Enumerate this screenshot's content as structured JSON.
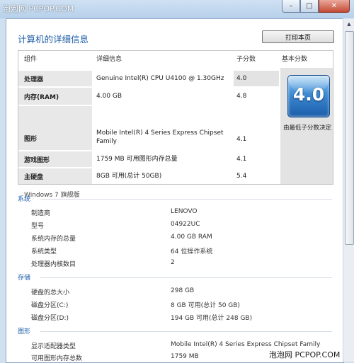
{
  "watermark": "泡泡网 PCPOP.COM",
  "footer_watermark": "泡泡网  PCPOP.COM",
  "window_buttons": {
    "minimize": "–",
    "maximize": "□",
    "close": "✕"
  },
  "page_title": "计算机的详细信息",
  "print_button": "打印本页",
  "table": {
    "headers": {
      "component": "组件",
      "detail": "详细信息",
      "subscore": "子分数",
      "basescore": "基本分数"
    },
    "rows": [
      {
        "name": "处理器",
        "detail": "Genuine Intel(R) CPU U4100 @ 1.30GHz",
        "score": "4.0"
      },
      {
        "name": "内存(RAM)",
        "detail": "4.00 GB",
        "score": "4.8"
      },
      {
        "name": "图形",
        "detail": "Mobile Intel(R) 4 Series Express Chipset Family",
        "score": "4.1"
      },
      {
        "name": "游戏图形",
        "detail": "1759 MB 可用图形内存总量",
        "score": "4.1"
      },
      {
        "name": "主硬盘",
        "detail": "8GB 可用(总计 50GB)",
        "score": "5.4"
      }
    ],
    "base_score": "4.0",
    "base_note": "由最低子分数决定",
    "edition": "Windows 7 旗舰版"
  },
  "sections": {
    "system": {
      "title": "系统",
      "items": [
        {
          "label": "制造商",
          "value": "LENOVO"
        },
        {
          "label": "型号",
          "value": "04922UC"
        },
        {
          "label": "系统内存的总量",
          "value": "4.00 GB RAM"
        },
        {
          "label": "系统类型",
          "value": "64 位操作系统"
        },
        {
          "label": "处理器内核数目",
          "value": "2"
        }
      ]
    },
    "storage": {
      "title": "存储",
      "items": [
        {
          "label": "硬盘的总大小",
          "value": "298 GB"
        },
        {
          "label": "磁盘分区(C:)",
          "value": "8 GB 可用(总计 50 GB)"
        },
        {
          "label": "磁盘分区(D:)",
          "value": "194 GB 可用(总计 248 GB)"
        }
      ]
    },
    "graphics": {
      "title": "图形",
      "items": [
        {
          "label": "显示适配器类型",
          "value": "Mobile Intel(R) 4 Series Express Chipset Family"
        },
        {
          "label": "可用图形内存总数",
          "value": "1759 MB"
        }
      ]
    }
  }
}
